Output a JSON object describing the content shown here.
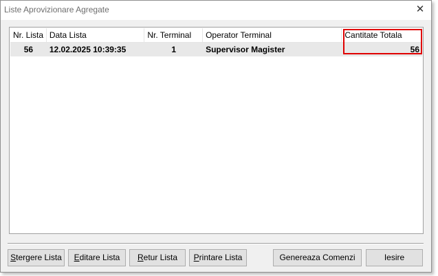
{
  "window": {
    "title": "Liste Aprovizionare Agregate",
    "close_glyph": "✕"
  },
  "table": {
    "columns": [
      "Nr. Lista",
      "Data Lista",
      "Nr. Terminal",
      "Operator Terminal",
      "Cantitate Totala"
    ],
    "rows": [
      [
        "56",
        "12.02.2025 10:39:35",
        "1",
        "Supervisor Magister",
        "56"
      ]
    ]
  },
  "buttons": {
    "stergere": {
      "mnemonic": "S",
      "rest": "tergere Lista"
    },
    "editare": {
      "mnemonic": "E",
      "rest": "ditare Lista"
    },
    "retur": {
      "mnemonic": "R",
      "rest": "etur Lista"
    },
    "printare": {
      "mnemonic": "P",
      "rest": "rintare Lista"
    },
    "genereaza": "Genereaza Comenzi",
    "iesire": "Iesire"
  },
  "colors": {
    "highlight_box": "#e00000",
    "selected_row": "#e8e8e8"
  }
}
